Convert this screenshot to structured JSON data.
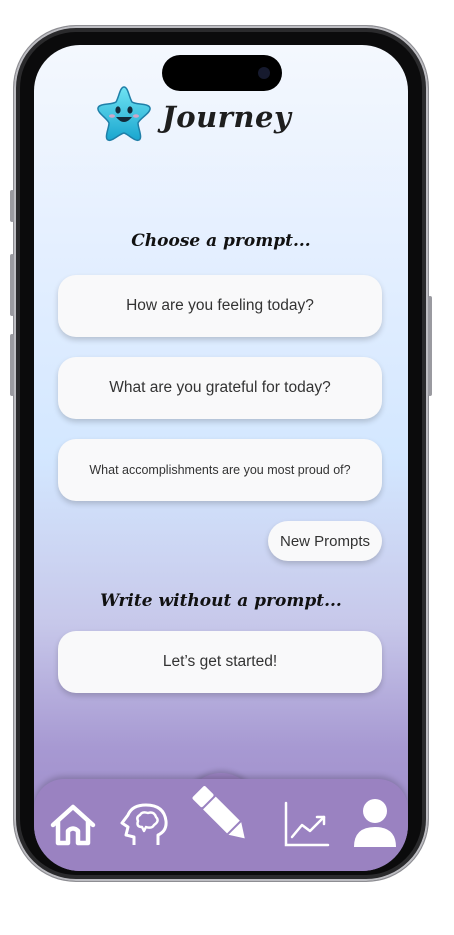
{
  "app": {
    "title": "Journey"
  },
  "prompt_section": {
    "title": "Choose a prompt...",
    "prompts": [
      "How are you feeling today?",
      "What are you grateful for today?",
      "What accomplishments are you most proud of?"
    ],
    "new_prompts_label": "New Prompts"
  },
  "freewrite_section": {
    "title": "Write without a prompt...",
    "start_label": "Let’s get started!"
  },
  "bottom_nav": {
    "items": [
      {
        "icon": "home-icon"
      },
      {
        "icon": "mind-icon"
      },
      {
        "icon": "pencil-icon",
        "active": true
      },
      {
        "icon": "chart-trend-icon"
      },
      {
        "icon": "profile-icon"
      }
    ]
  },
  "colors": {
    "nav_background": "#9a82c1",
    "card_background": "#f9f9fa",
    "logo_star": "#39c6e0"
  }
}
